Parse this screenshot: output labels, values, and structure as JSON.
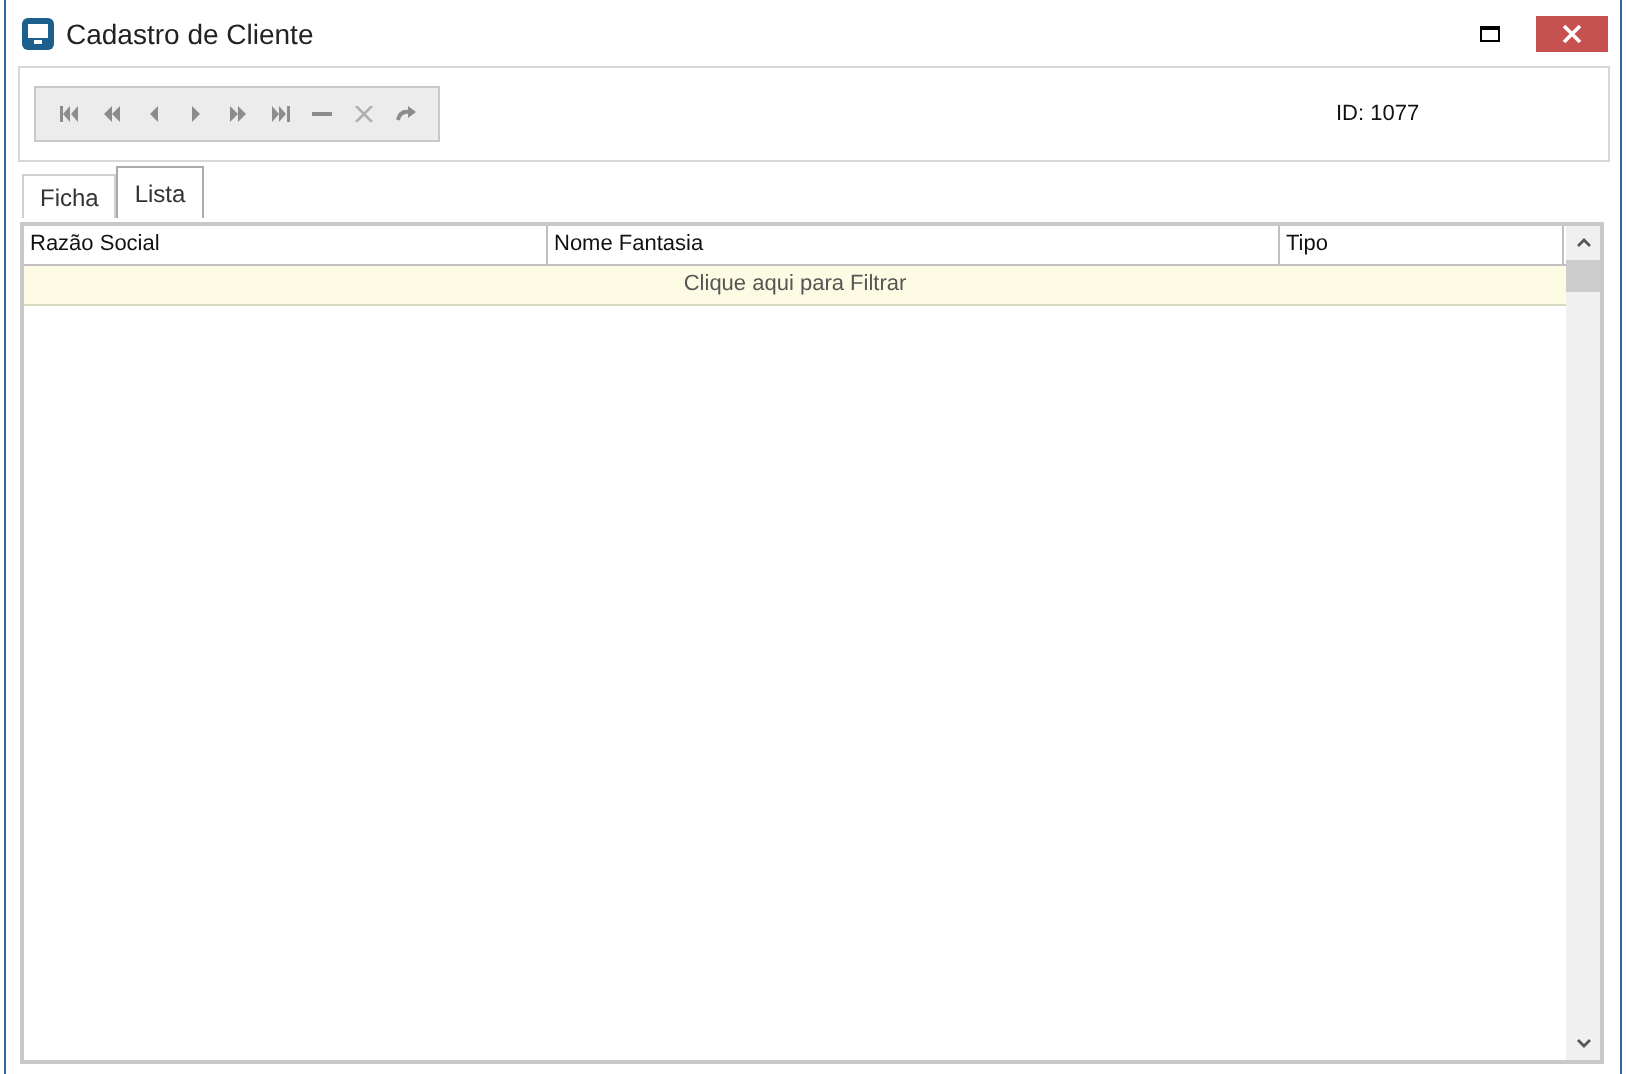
{
  "window": {
    "title": "Cadastro de Cliente"
  },
  "record_id": "ID: 1077",
  "tabs": [
    {
      "label": "Ficha",
      "selected": false
    },
    {
      "label": "Lista",
      "selected": true
    }
  ],
  "table": {
    "columns": [
      "Razão Social",
      "Nome Fantasia",
      "Tipo"
    ],
    "filter_row": "Clique aqui para Filtrar"
  }
}
